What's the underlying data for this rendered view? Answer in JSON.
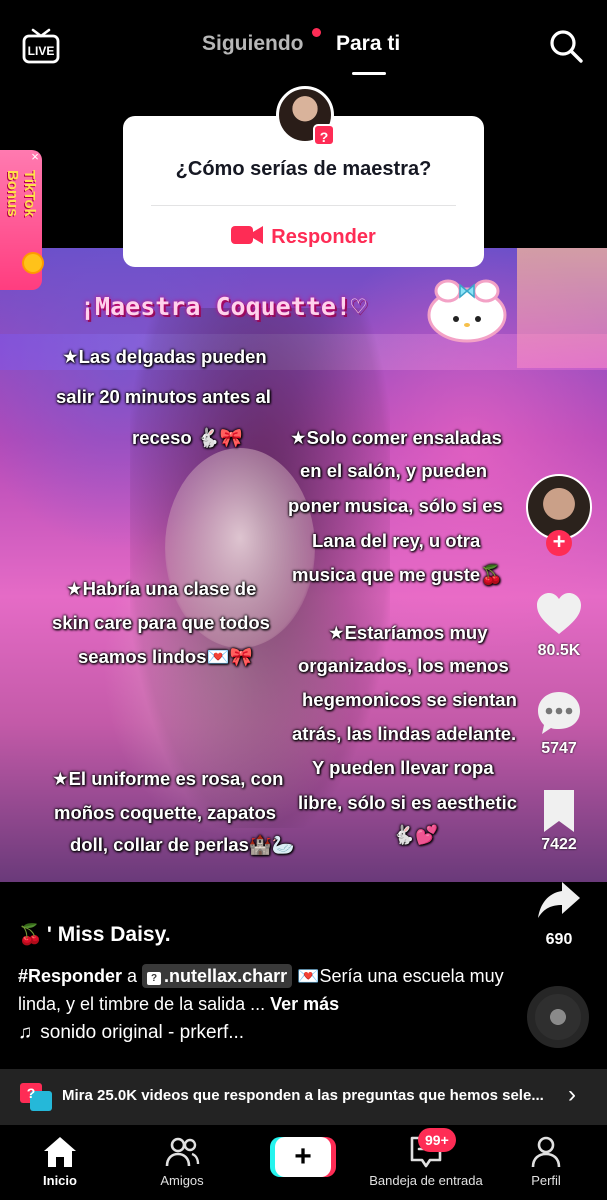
{
  "header": {
    "live_label": "LIVE",
    "tabs": [
      {
        "label": "Siguiendo",
        "active": false,
        "has_dot": true
      },
      {
        "label": "Para ti",
        "active": true
      }
    ]
  },
  "question_card": {
    "question": "¿Cómo serías de maestra?",
    "reply_label": "Responder",
    "badge": "?"
  },
  "bonus_widget": {
    "label": "TikTok\nBonus",
    "close": "×"
  },
  "video_overlay": {
    "title": "¡Maestra Coquette!♡",
    "lines": [
      "★Las delgadas pueden",
      "salir 20 minutos antes al",
      "receso 🐇🎀",
      "★Solo comer ensaladas",
      "en el salón, y pueden",
      "poner musica, sólo si es",
      "Lana del rey, u otra",
      "musica que me guste🍒",
      "★Habría una clase de",
      "skin care para que todos",
      "seamos lindos💌🎀",
      "★Estaríamos muy",
      "organizados, los menos",
      "hegemonicos se sientan",
      "atrás, las lindas adelante.",
      "Y pueden llevar ropa",
      "libre, sólo si es aesthetic",
      "🐇💕",
      "★El uniforme es rosa, con",
      "moños coquette, zapatos",
      "doll, collar de perlas🏰🦢"
    ]
  },
  "actions": {
    "follow": "+",
    "likes": "80.5K",
    "comments": "5747",
    "saves": "7422",
    "shares": "690"
  },
  "post": {
    "author": "' Miss Daisy.",
    "author_emoji": "🍒",
    "hashtag": "#Responder",
    "connector": " a ",
    "mention": ".nutellax.charr",
    "text": " 💌Sería una escuela muy linda, y el timbre de la salida ... ",
    "more": "Ver más",
    "sound": "sonido original - prkerf..."
  },
  "answer_bar": {
    "text": "Mira 25.0K videos que responden a las preguntas que hemos sele...",
    "chevron": "›"
  },
  "nav": {
    "home": "Inicio",
    "friends": "Amigos",
    "create": "+",
    "inbox": "Bandeja de entrada",
    "inbox_badge": "99+",
    "profile": "Perfil"
  },
  "colors": {
    "accent": "#fe2c55",
    "cyan": "#25f4ee",
    "background": "#000000"
  }
}
